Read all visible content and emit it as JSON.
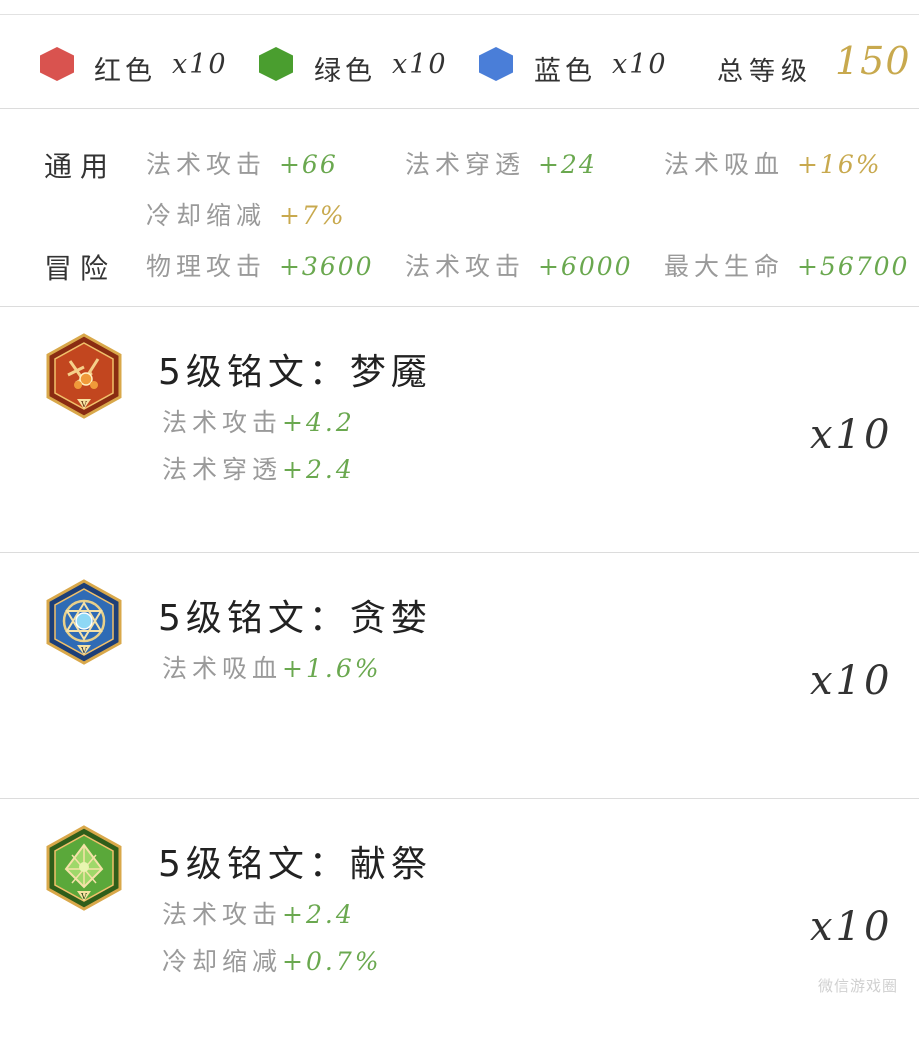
{
  "colors": {
    "red_hex": "#d9534f",
    "green_hex": "#4a9e2f",
    "blue_hex": "#4a7ed8",
    "stat_green": "#6aa84f",
    "gold": "#c8a94e"
  },
  "summary": {
    "items": [
      {
        "label": "红色",
        "count": "x10",
        "icon": "red-hexagon-icon"
      },
      {
        "label": "绿色",
        "count": "x10",
        "icon": "green-hexagon-icon"
      },
      {
        "label": "蓝色",
        "count": "x10",
        "icon": "blue-hexagon-icon"
      }
    ],
    "total_label": "总等级",
    "total_value": "150"
  },
  "stats": {
    "general": {
      "label": "通用",
      "items": [
        {
          "name": "法术攻击",
          "value": "+66"
        },
        {
          "name": "法术穿透",
          "value": "+24"
        },
        {
          "name": "法术吸血",
          "value": "+16%"
        },
        {
          "name": "冷却缩减",
          "value": "+7%"
        }
      ]
    },
    "adventure": {
      "label": "冒险",
      "items": [
        {
          "name": "物理攻击",
          "value": "+3600"
        },
        {
          "name": "法术攻击",
          "value": "+6000"
        },
        {
          "name": "最大生命",
          "value": "+56700"
        }
      ]
    }
  },
  "runes": [
    {
      "title": "5级铭文：梦魇",
      "icon": "red-rune-icon",
      "stats": [
        {
          "name": "法术攻击",
          "value": "+4.2"
        },
        {
          "name": "法术穿透",
          "value": "+2.4"
        }
      ],
      "quantity": "x10"
    },
    {
      "title": "5级铭文：贪婪",
      "icon": "blue-rune-icon",
      "stats": [
        {
          "name": "法术吸血",
          "value": "+1.6%"
        }
      ],
      "quantity": "x10"
    },
    {
      "title": "5级铭文：献祭",
      "icon": "green-rune-icon",
      "stats": [
        {
          "name": "法术攻击",
          "value": "+2.4"
        },
        {
          "name": "冷却缩减",
          "value": "+0.7%"
        }
      ],
      "quantity": "x10"
    }
  ],
  "watermark": "微信游戏圈"
}
